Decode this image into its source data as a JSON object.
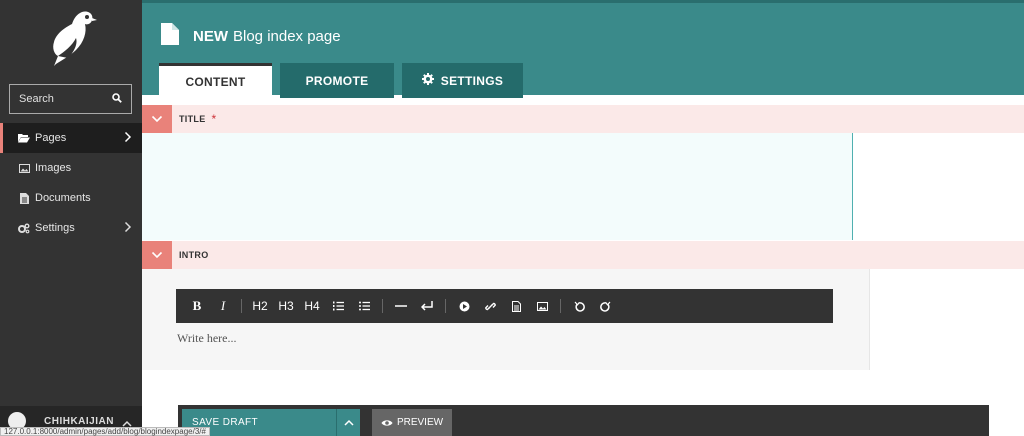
{
  "sidebar": {
    "search_label": "Search",
    "items": [
      {
        "label": "Pages",
        "icon": "folder-open-icon"
      },
      {
        "label": "Images",
        "icon": "image-icon"
      },
      {
        "label": "Documents",
        "icon": "document-icon"
      },
      {
        "label": "Settings",
        "icon": "cogs-icon"
      }
    ],
    "account_name": "CHIHKAIJIAN"
  },
  "header": {
    "title_prefix": "NEW",
    "title": "Blog index page",
    "tabs": [
      {
        "label": "CONTENT"
      },
      {
        "label": "PROMOTE"
      },
      {
        "label": "SETTINGS"
      }
    ]
  },
  "fields": {
    "title_label": "TITLE",
    "required_marker": "*",
    "intro_label": "INTRO",
    "intro_placeholder": "Write here..."
  },
  "toolbar": {
    "bold": "B",
    "italic": "I",
    "h2": "H2",
    "h3": "H3",
    "h4": "H4"
  },
  "footer": {
    "save_label": "SAVE DRAFT",
    "preview_label": "PREVIEW"
  },
  "status_url": "127.0.0.1:8000/admin/pages/add/blog/blogindexpage/3/#",
  "colors": {
    "accent": "#3a8a8a",
    "sidebar": "#333333",
    "field_label_bg": "#fbe9e8",
    "toggle": "#e9827a"
  }
}
